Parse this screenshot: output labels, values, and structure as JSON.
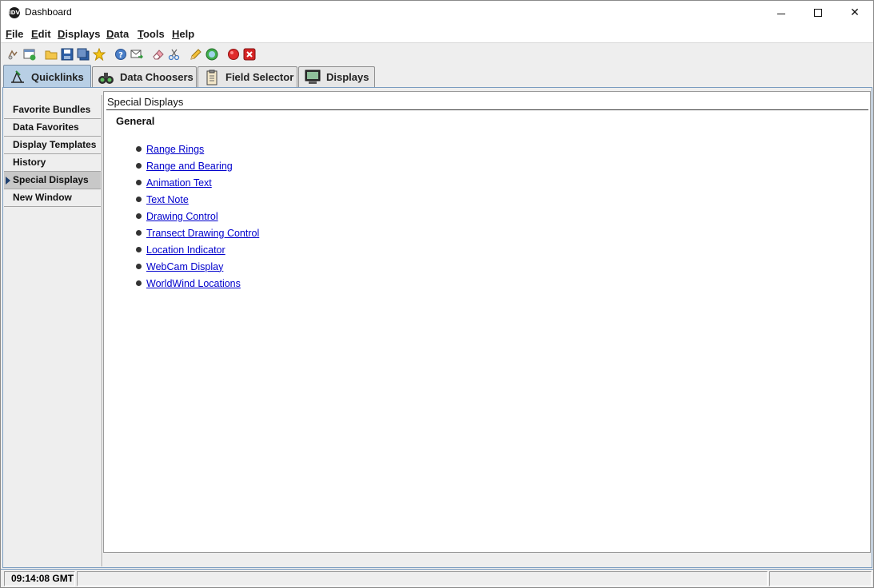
{
  "window": {
    "title": "Dashboard",
    "logo_text": "IDV"
  },
  "menubar": [
    {
      "label": "File",
      "mnemonic": "F",
      "rest": "ile"
    },
    {
      "label": "Edit",
      "mnemonic": "E",
      "rest": "dit"
    },
    {
      "label": "Displays",
      "mnemonic": "D",
      "rest": "isplays"
    },
    {
      "label": "Data",
      "mnemonic": "D",
      "rest": "ata"
    },
    {
      "label": "Tools",
      "mnemonic": "T",
      "rest": "ools"
    },
    {
      "label": "Help",
      "mnemonic": "H",
      "rest": "elp"
    }
  ],
  "toolbar_icons": [
    "new-display-icon",
    "add-window-icon",
    "open-folder-icon",
    "save-icon",
    "save-as-icon",
    "favorite-star-icon",
    "help-icon",
    "send-mail-icon",
    "eraser-icon",
    "cut-icon",
    "pencil-icon",
    "globe-refresh-icon",
    "record-icon",
    "stop-icon"
  ],
  "tabs": [
    {
      "label": "Quicklinks",
      "icon": "quicklinks-icon",
      "active": true
    },
    {
      "label": "Data Choosers",
      "icon": "binoculars-icon",
      "active": false
    },
    {
      "label": "Field Selector",
      "icon": "clipboard-icon",
      "active": false
    },
    {
      "label": "Displays",
      "icon": "monitor-icon",
      "active": false
    }
  ],
  "sidebar": {
    "items": [
      {
        "label": "Favorite Bundles",
        "selected": false
      },
      {
        "label": "Data Favorites",
        "selected": false
      },
      {
        "label": "Display Templates",
        "selected": false
      },
      {
        "label": "History",
        "selected": false
      },
      {
        "label": "Special Displays",
        "selected": true
      },
      {
        "label": "New Window",
        "selected": false
      }
    ]
  },
  "content": {
    "title": "Special Displays",
    "section": "General",
    "links": [
      "Range Rings",
      "Range and Bearing",
      "Animation Text",
      "Text Note",
      "Drawing Control",
      "Transect Drawing Control",
      "Location Indicator",
      "WebCam Display",
      "WorldWind Locations"
    ]
  },
  "statusbar": {
    "time": "09:14:08 GMT",
    "message": "",
    "extra": ""
  },
  "colors": {
    "active_tab": "#b8cfe5",
    "link": "#0000cc",
    "panel_border": "#7a9cc0"
  }
}
